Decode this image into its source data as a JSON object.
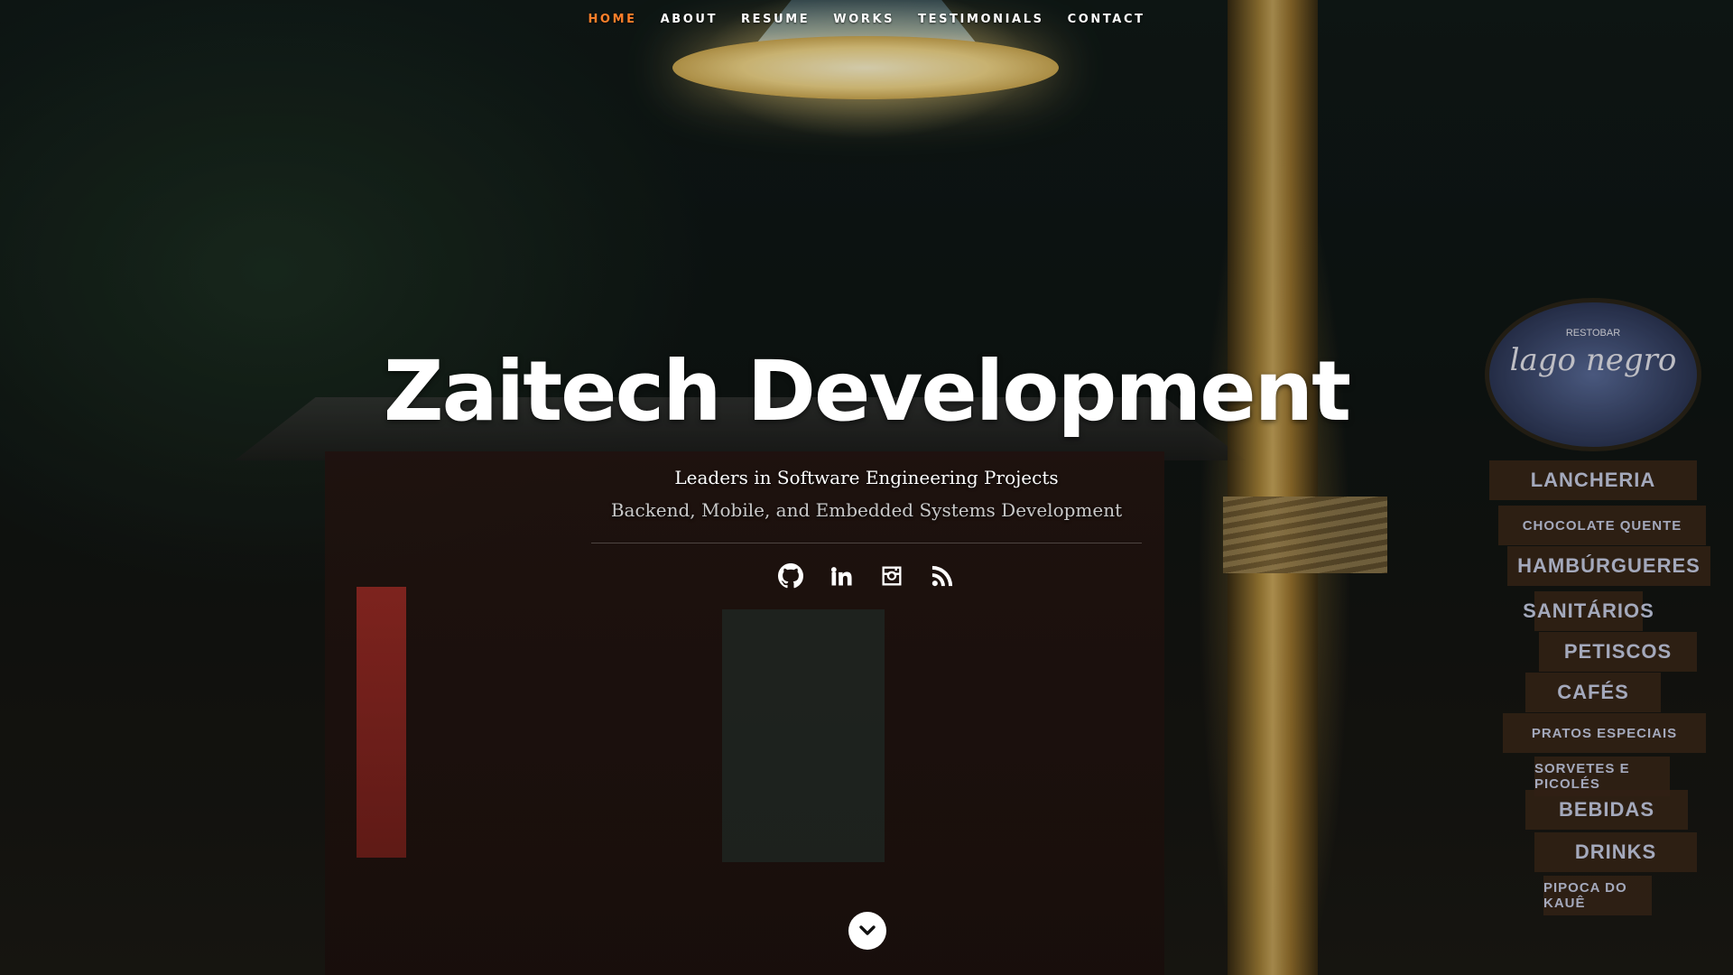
{
  "nav": {
    "items": [
      {
        "label": "HOME",
        "active": true
      },
      {
        "label": "ABOUT"
      },
      {
        "label": "RESUME"
      },
      {
        "label": "WORKS"
      },
      {
        "label": "TESTIMONIALS"
      },
      {
        "label": "CONTACT"
      }
    ],
    "active_color": "#ff7f2a"
  },
  "hero": {
    "title": "Zaitech Development",
    "tagline": "Leaders in Software Engineering Projects",
    "subtitle": "Backend, Mobile, and Embedded Systems Development"
  },
  "social": {
    "icons": [
      "github-icon",
      "linkedin-icon",
      "instagram-icon",
      "rss-icon"
    ]
  },
  "scroll": {
    "icon": "chevron-down-icon"
  },
  "background_signs": {
    "oval_line1": "RESTOBAR",
    "oval_line2": "lago negro",
    "boards": [
      "LANCHERIA",
      "CHOCOLATE QUENTE",
      "HAMBÚRGUERES",
      "SANITÁRIOS",
      "PETISCOS",
      "CAFÉS",
      "PRATOS ESPECIAIS",
      "SORVETES E PICOLÉS",
      "BEBIDAS",
      "DRINKS",
      "PIPOCA DO KAUÊ"
    ]
  }
}
